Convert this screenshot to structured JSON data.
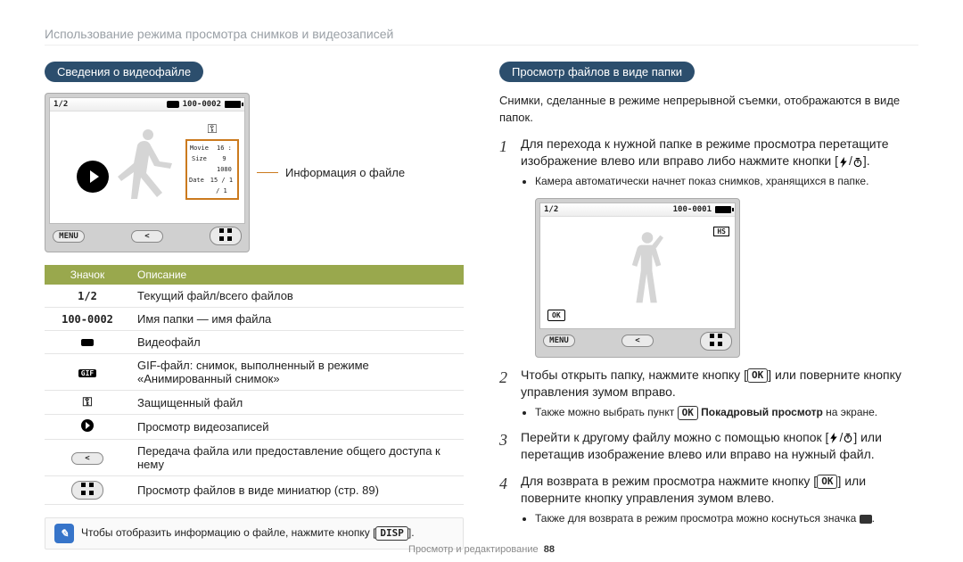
{
  "breadcrumb": "Использование режима просмотра снимков и видеозаписей",
  "left": {
    "pill": "Сведения о видеофайле",
    "lcd": {
      "counter": "1/2",
      "fileno": "100-0002",
      "info_box": {
        "l1a": "Movie Size",
        "l1b": "16 : 9  1080",
        "l2a": "Date",
        "l2b": "15 / 1 / 1"
      },
      "footer_menu": "MENU"
    },
    "callout": "Информация о файле",
    "table": {
      "th1": "Значок",
      "th2": "Описание",
      "rows": [
        {
          "icon_text": "1/2",
          "icon_name": "counter",
          "desc": "Текущий файл/всего файлов"
        },
        {
          "icon_text": "100-0002",
          "icon_name": "filename",
          "desc": "Имя папки — имя файла"
        },
        {
          "icon_text": "",
          "icon_name": "film-icon",
          "desc": "Видеофайл"
        },
        {
          "icon_text": "GIF",
          "icon_name": "gif-icon",
          "desc": "GIF-файл: снимок, выполненный в режиме «Анимированный снимок»"
        },
        {
          "icon_text": "",
          "icon_name": "lock-icon",
          "desc": "Защищенный файл"
        },
        {
          "icon_text": "",
          "icon_name": "play-icon",
          "desc": "Просмотр видеозаписей"
        },
        {
          "icon_text": "",
          "icon_name": "share-icon",
          "desc": "Передача файла или предоставление общего доступа к нему"
        },
        {
          "icon_text": "",
          "icon_name": "grid-icon",
          "desc": "Просмотр файлов в виде миниатюр (стр. 89)"
        }
      ]
    },
    "tip": {
      "text_a": "Чтобы отобразить информацию о файле, нажмите кнопку [",
      "text_b": "].",
      "key": "DISP"
    }
  },
  "right": {
    "pill": "Просмотр файлов в виде папки",
    "intro": "Снимки, сделанные в режиме непрерывной съемки, отображаются в виде папок.",
    "lcd": {
      "counter": "1/2",
      "fileno": "100-0001",
      "hs": "HS",
      "ok": "OK",
      "footer_menu": "MENU"
    },
    "steps": {
      "s1a": "Для перехода к нужной папке в режиме просмотра перетащите изображение влево или вправо либо нажмите кнопки [",
      "s1b": "/",
      "s1c": "].",
      "s1_sub1": "Камера автоматически начнет показ снимков, хранящихся в папке.",
      "s2a": "Чтобы открыть папку, нажмите кнопку [",
      "s2b": "] или поверните кнопку управления зумом вправо.",
      "s2_ok": "OK",
      "s2_sub_a": "Также можно выбрать пункт ",
      "s2_sub_ok": "OK",
      "s2_sub_b": " Покадровый просмотр",
      "s2_sub_c": " на экране.",
      "s3a": "Перейти к другому файлу можно с помощью кнопок [",
      "s3b": "/",
      "s3c": "] или перетащив изображение влево или вправо на нужный файл.",
      "s4a": "Для возврата в режим просмотра нажмите кнопку [",
      "s4b": "] или поверните кнопку управления зумом влево.",
      "s4_ok": "OK",
      "s4_sub_a": "Также для возврата в режим просмотра можно коснуться значка ",
      "s4_sub_b": "."
    }
  },
  "footer": {
    "section": "Просмотр и редактирование",
    "page": "88"
  }
}
